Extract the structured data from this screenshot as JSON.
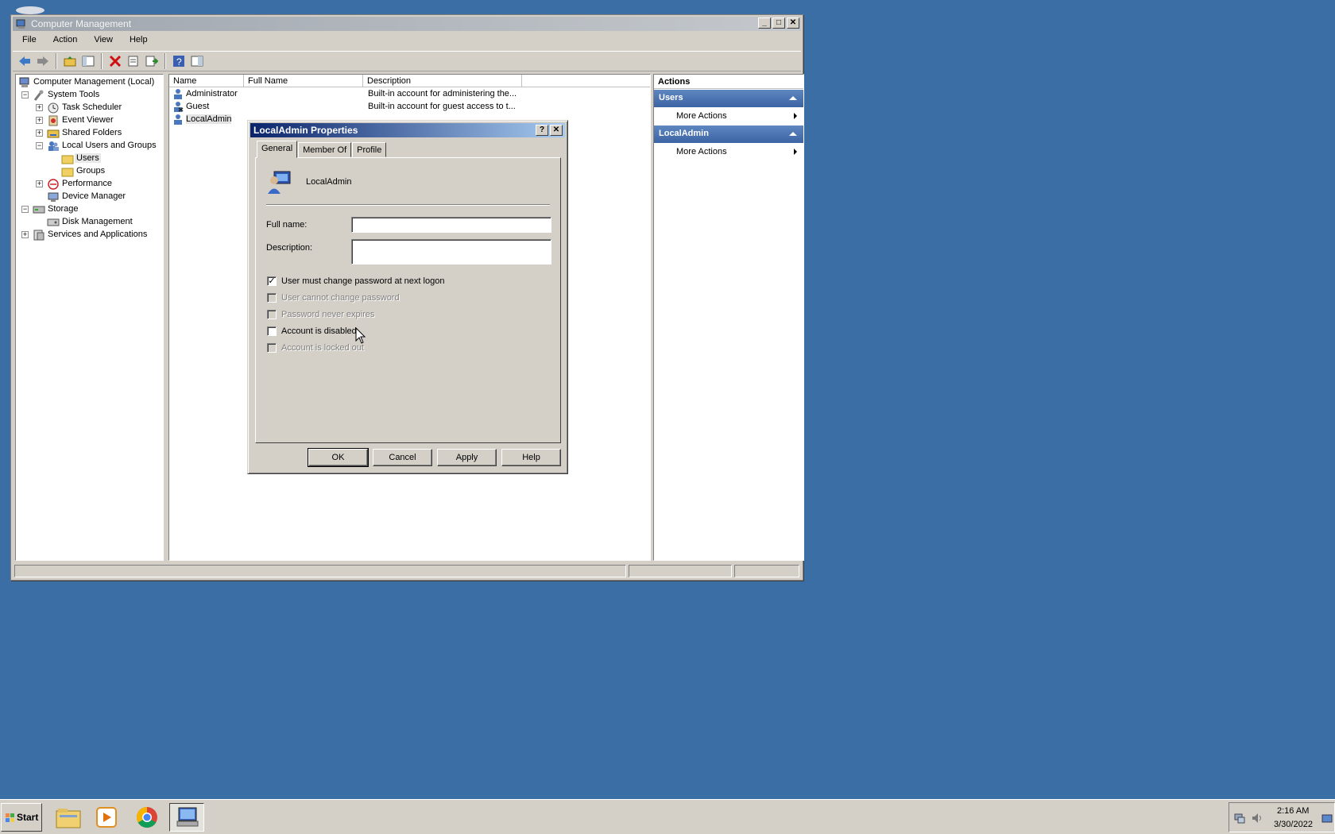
{
  "window": {
    "title": "Computer Management",
    "menu": [
      "File",
      "Action",
      "View",
      "Help"
    ]
  },
  "tree": [
    {
      "label": "Computer Management (Local)"
    },
    {
      "label": "System Tools"
    },
    {
      "label": "Task Scheduler"
    },
    {
      "label": "Event Viewer"
    },
    {
      "label": "Shared Folders"
    },
    {
      "label": "Local Users and Groups"
    },
    {
      "label": "Users"
    },
    {
      "label": "Groups"
    },
    {
      "label": "Performance"
    },
    {
      "label": "Device Manager"
    },
    {
      "label": "Storage"
    },
    {
      "label": "Disk Management"
    },
    {
      "label": "Services and Applications"
    }
  ],
  "list": {
    "columns": [
      "Name",
      "Full Name",
      "Description"
    ],
    "rows": [
      {
        "name": "Administrator",
        "full_name": "",
        "description": "Built-in account for administering the..."
      },
      {
        "name": "Guest",
        "full_name": "",
        "description": "Built-in account for guest access to t..."
      },
      {
        "name": "LocalAdmin",
        "full_name": "",
        "description": ""
      }
    ]
  },
  "actions": {
    "header": "Actions",
    "sections": [
      {
        "title": "Users",
        "item": "More Actions"
      },
      {
        "title": "LocalAdmin",
        "item": "More Actions"
      }
    ]
  },
  "dialog": {
    "title": "LocalAdmin Properties",
    "tabs": [
      "General",
      "Member Of",
      "Profile"
    ],
    "user_name": "LocalAdmin",
    "full_name_label": "Full name:",
    "full_name_value": "",
    "description_label": "Description:",
    "description_value": "",
    "checkboxes": [
      {
        "label": "User must change password at next logon",
        "checked": true,
        "enabled": true
      },
      {
        "label": "User cannot change password",
        "checked": false,
        "enabled": false
      },
      {
        "label": "Password never expires",
        "checked": false,
        "enabled": false
      },
      {
        "label": "Account is disabled",
        "checked": false,
        "enabled": true
      },
      {
        "label": "Account is locked out",
        "checked": false,
        "enabled": false
      }
    ],
    "buttons": {
      "ok": "OK",
      "cancel": "Cancel",
      "apply": "Apply",
      "help": "Help"
    }
  },
  "taskbar": {
    "start": "Start",
    "time": "2:16 AM",
    "date": "3/30/2022"
  }
}
